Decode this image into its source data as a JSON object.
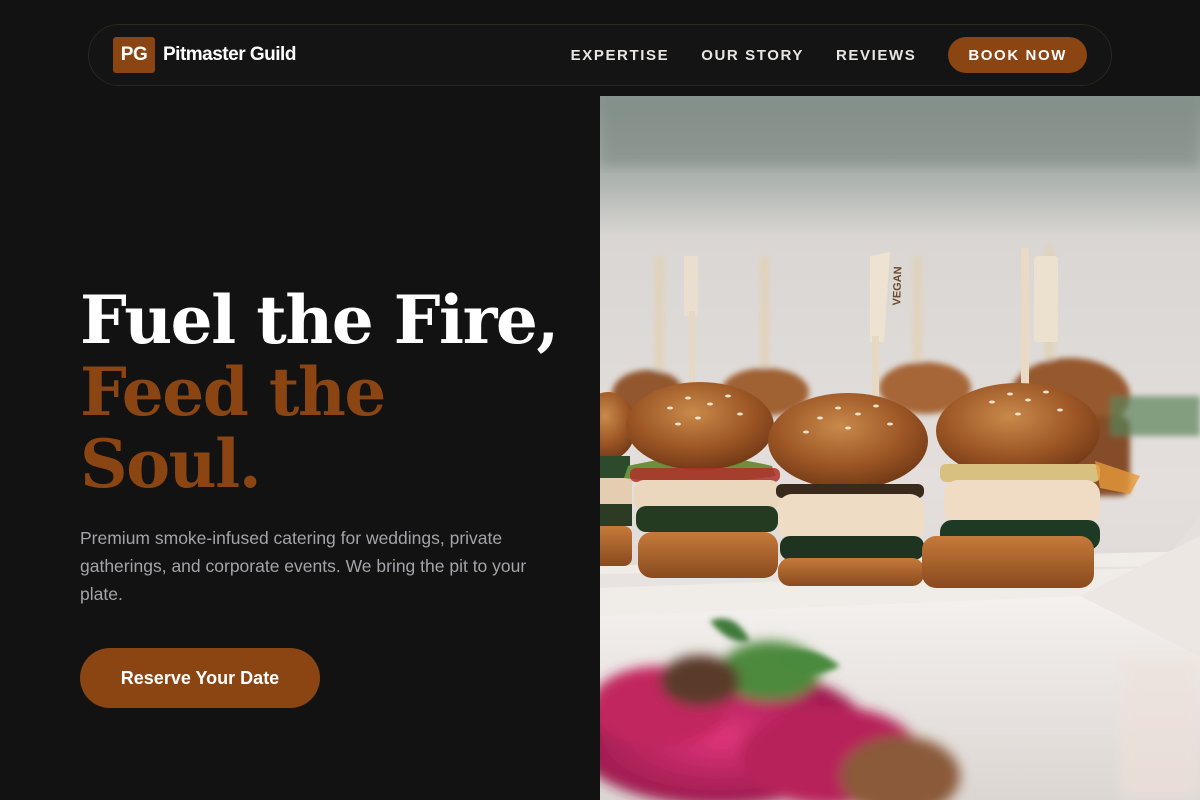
{
  "brand": {
    "mark": "PG",
    "name": "Pitmaster Guild"
  },
  "nav": {
    "links": [
      "EXPERTISE",
      "OUR STORY",
      "REVIEWS"
    ],
    "cta": "BOOK NOW"
  },
  "hero": {
    "title_line1": "Fuel the Fire,",
    "title_accent_line1": "Feed the",
    "title_accent_line2": "Soul.",
    "subtitle": "Premium smoke-infused catering for weddings, private gatherings, and corporate events. We bring the pit to your plate.",
    "cta": "Reserve Your Date"
  },
  "image": {
    "pick_label": "VEGAN"
  },
  "colors": {
    "background": "#121212",
    "accent": "#8b4513",
    "text": "#ffffff",
    "muted": "#a4a4a8"
  }
}
